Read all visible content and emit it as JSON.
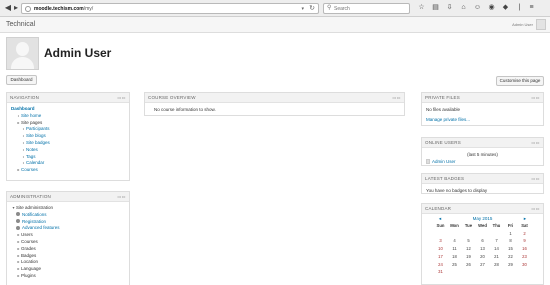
{
  "browser": {
    "url_host": "moodle.techism.com",
    "url_path": "/my/",
    "search_placeholder": "Search",
    "icons": [
      "back-icon",
      "forward-icon",
      "reload-icon",
      "star-icon",
      "reading-list-icon",
      "download-icon",
      "home-icon",
      "sync-icon",
      "pocket-icon",
      "extension-icon",
      "menu-icon"
    ]
  },
  "site": {
    "brand": "Technical",
    "user_menu": "Admin User"
  },
  "page": {
    "title": "Admin User",
    "breadcrumb": "Dashboard",
    "customise_label": "Customise this page"
  },
  "navigation": {
    "title": "NAVIGATION",
    "items": [
      {
        "label": "Dashboard",
        "level": 0,
        "marker": "",
        "style": "bold"
      },
      {
        "label": "Site home",
        "level": 1,
        "marker": "•",
        "style": "link"
      },
      {
        "label": "Site pages",
        "level": 1,
        "marker": "▸",
        "style": "plain"
      },
      {
        "label": "Participants",
        "level": 2,
        "marker": "•",
        "style": "link"
      },
      {
        "label": "Site blogs",
        "level": 2,
        "marker": "•",
        "style": "link"
      },
      {
        "label": "Site badges",
        "level": 2,
        "marker": "•",
        "style": "link"
      },
      {
        "label": "Notes",
        "level": 2,
        "marker": "•",
        "style": "link"
      },
      {
        "label": "Tags",
        "level": 2,
        "marker": "•",
        "style": "link"
      },
      {
        "label": "Calendar",
        "level": 2,
        "marker": "•",
        "style": "link"
      },
      {
        "label": "Courses",
        "level": 1,
        "marker": "▸",
        "style": "link"
      }
    ]
  },
  "administration": {
    "title": "ADMINISTRATION",
    "items": [
      {
        "label": "Site administration",
        "level": 0,
        "marker": "▾",
        "style": "plain"
      },
      {
        "label": "Notifications",
        "level": 1,
        "marker": "gear",
        "style": "link"
      },
      {
        "label": "Registration",
        "level": 1,
        "marker": "gear",
        "style": "link"
      },
      {
        "label": "Advanced features",
        "level": 1,
        "marker": "gear",
        "style": "link"
      },
      {
        "label": "Users",
        "level": 1,
        "marker": "▸",
        "style": "plain"
      },
      {
        "label": "Courses",
        "level": 1,
        "marker": "▸",
        "style": "plain"
      },
      {
        "label": "Grades",
        "level": 1,
        "marker": "▸",
        "style": "plain"
      },
      {
        "label": "Badges",
        "level": 1,
        "marker": "▸",
        "style": "plain"
      },
      {
        "label": "Location",
        "level": 1,
        "marker": "▸",
        "style": "plain"
      },
      {
        "label": "Language",
        "level": 1,
        "marker": "▸",
        "style": "plain"
      },
      {
        "label": "Plugins",
        "level": 1,
        "marker": "▸",
        "style": "plain"
      }
    ]
  },
  "course_overview": {
    "title": "COURSE OVERVIEW",
    "message": "No course information to show."
  },
  "private_files": {
    "title": "PRIVATE FILES",
    "message": "No files available",
    "link": "Manage private files..."
  },
  "online_users": {
    "title": "ONLINE USERS",
    "subtitle": "(last 5 minutes)",
    "users": [
      "Admin User"
    ]
  },
  "latest_badges": {
    "title": "LATEST BADGES",
    "message": "You have no badges to display"
  },
  "calendar": {
    "title": "CALENDAR",
    "month": "May 2015",
    "prev": "◄",
    "next": "►",
    "weekdays": [
      "Sun",
      "Mon",
      "Tue",
      "Wed",
      "Thu",
      "Fri",
      "Sat"
    ],
    "weeks": [
      [
        "",
        "",
        "",
        "",
        "",
        "1",
        "2"
      ],
      [
        "3",
        "4",
        "5",
        "6",
        "7",
        "8",
        "9"
      ],
      [
        "10",
        "11",
        "12",
        "13",
        "14",
        "15",
        "16"
      ],
      [
        "17",
        "18",
        "19",
        "20",
        "21",
        "22",
        "23"
      ],
      [
        "24",
        "25",
        "26",
        "27",
        "28",
        "29",
        "30"
      ],
      [
        "31",
        "",
        "",
        "",
        "",
        "",
        ""
      ]
    ]
  },
  "block_controls": "▭▭"
}
